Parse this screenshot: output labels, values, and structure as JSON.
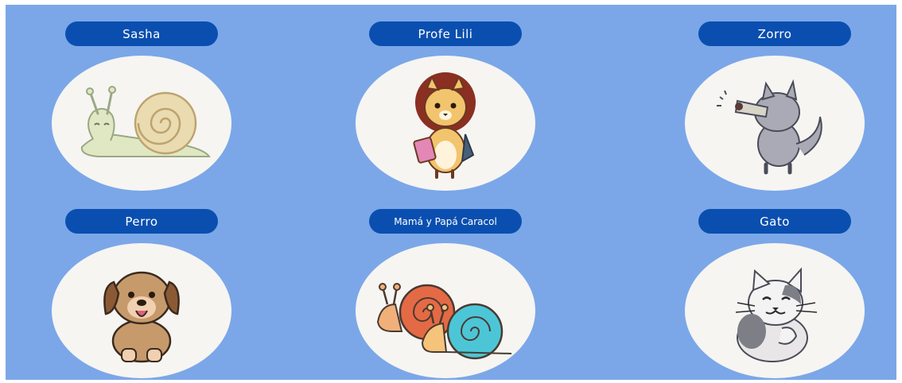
{
  "characters": [
    {
      "name": "Sasha",
      "icon": "snail-icon"
    },
    {
      "name": "Profe Lili",
      "icon": "lion-icon"
    },
    {
      "name": "Zorro",
      "icon": "wolf-icon"
    },
    {
      "name": "Perro",
      "icon": "dog-icon"
    },
    {
      "name": "Mamá y Papá Caracol",
      "icon": "snail-couple-icon"
    },
    {
      "name": "Gato",
      "icon": "cat-icon"
    }
  ],
  "colors": {
    "background": "#7ba7e8",
    "label_pill": "#0a4fb0",
    "oval": "#f6f5f2"
  }
}
